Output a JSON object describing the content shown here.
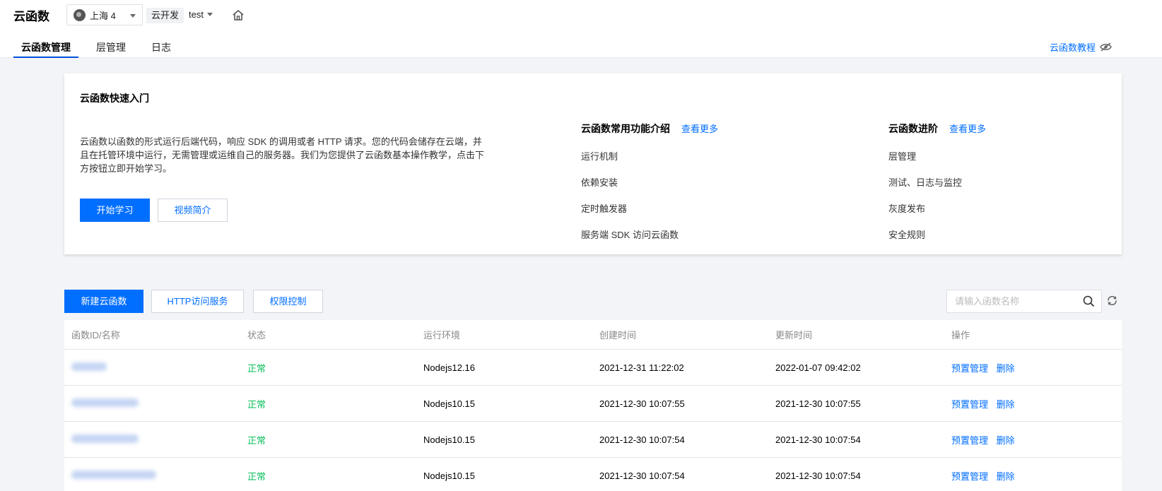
{
  "header": {
    "title": "云函数",
    "region": "上海 4",
    "env_tag": "云开发",
    "env_name": "test"
  },
  "tabs": [
    {
      "label": "云函数管理",
      "active": true
    },
    {
      "label": "层管理",
      "active": false
    },
    {
      "label": "日志",
      "active": false
    }
  ],
  "tutorial_link": "云函数教程",
  "quickstart": {
    "title": "云函数快速入门",
    "description": "云函数以函数的形式运行后端代码，响应 SDK 的调用或者 HTTP 请求。您的代码会储存在云端，并且在托管环境中运行，无需管理或运维自己的服务器。我们为您提供了云函数基本操作教学，点击下方按钮立即开始学习。",
    "start_button": "开始学习",
    "video_button": "视频简介",
    "features": {
      "title": "云函数常用功能介绍",
      "more": "查看更多",
      "links": [
        "运行机制",
        "依赖安装",
        "定时触发器",
        "服务端 SDK 访问云函数"
      ]
    },
    "advanced": {
      "title": "云函数进阶",
      "more": "查看更多",
      "links": [
        "层管理",
        "测试、日志与监控",
        "灰度发布",
        "安全规则"
      ]
    }
  },
  "toolbar": {
    "create_button": "新建云函数",
    "http_button": "HTTP访问服务",
    "permission_button": "权限控制",
    "search_placeholder": "请输入函数名称"
  },
  "table": {
    "columns": [
      "函数ID/名称",
      "状态",
      "运行环境",
      "创建时间",
      "更新时间",
      "操作"
    ],
    "rows": [
      {
        "status": "正常",
        "runtime": "Nodejs12.16",
        "created": "2021-12-31 11:22:02",
        "updated": "2022-01-07 09:42:02"
      },
      {
        "status": "正常",
        "runtime": "Nodejs10.15",
        "created": "2021-12-30 10:07:55",
        "updated": "2021-12-30 10:07:55"
      },
      {
        "status": "正常",
        "runtime": "Nodejs10.15",
        "created": "2021-12-30 10:07:54",
        "updated": "2021-12-30 10:07:54"
      },
      {
        "status": "正常",
        "runtime": "Nodejs10.15",
        "created": "2021-12-30 10:07:54",
        "updated": "2021-12-30 10:07:54"
      }
    ],
    "actions": {
      "provision": "预置管理",
      "delete": "删除"
    }
  },
  "colors": {
    "primary": "#006eff",
    "status_ok": "#0abf5b",
    "tab_underline": "#0052d9"
  },
  "icons": [
    "globe-icon",
    "home-icon",
    "eye-off-icon",
    "search-icon",
    "refresh-icon"
  ]
}
